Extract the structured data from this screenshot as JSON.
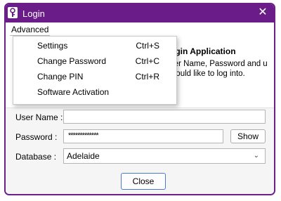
{
  "window": {
    "title": "Login",
    "close_glyph": "✕"
  },
  "menubar": {
    "advanced_label": "Advanced"
  },
  "dropdown": {
    "items": [
      {
        "label": "Settings",
        "shortcut": "Ctrl+S"
      },
      {
        "label": "Change Password",
        "shortcut": "Ctrl+C"
      },
      {
        "label": "Change PIN",
        "shortcut": "Ctrl+R"
      },
      {
        "label": "Software Activation",
        "shortcut": ""
      }
    ]
  },
  "banner": {
    "title": "ogin Application",
    "desc": "ser Name, Password and u would like to log into."
  },
  "form": {
    "username_label": "User Name :",
    "username_value": "",
    "password_label": "Password :",
    "password_mask": "*************",
    "show_label": "Show",
    "database_label": "Database :",
    "database_value": "Adelaide",
    "close_label": "Close"
  },
  "colors": {
    "titlebar": "#6a1c88",
    "accent_border": "#4a7bd0"
  },
  "icons": {
    "app": "lock-key-icon",
    "close": "close-icon",
    "dropdown": "chevron-down-icon"
  }
}
